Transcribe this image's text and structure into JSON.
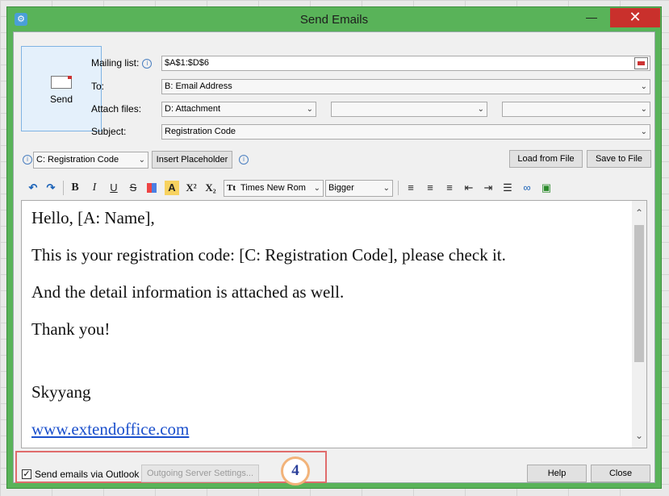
{
  "window": {
    "title": "Send Emails",
    "minimize_glyph": "—",
    "close_glyph": "✕"
  },
  "send_button": {
    "label": "Send",
    "icon": "envelope-icon"
  },
  "fields": {
    "mailing_list": {
      "label": "Mailing list:",
      "value": "$A$1:$D$6"
    },
    "to": {
      "label": "To:",
      "value": "B: Email Address"
    },
    "attach_files": {
      "label": "Attach files:",
      "values": [
        "D: Attachment",
        "",
        ""
      ]
    },
    "subject": {
      "label": "Subject:",
      "value": "Registration Code"
    }
  },
  "placeholder_row": {
    "field_value": "C: Registration Code",
    "insert_label": "Insert Placeholder",
    "load_label": "Load from File",
    "save_label": "Save to File"
  },
  "format_toolbar": {
    "bold": "B",
    "italic": "I",
    "underline": "U",
    "strike": "S",
    "font_color": "A",
    "superscript": "X²",
    "subscript": "X₂",
    "font_name": "Times New Rom",
    "font_size": "Bigger",
    "font_glyph": "Tt"
  },
  "editor": {
    "lines": [
      "Hello, [A: Name],",
      "This is your registration code: [C: Registration Code], please check it.",
      "And the detail information is attached as well.",
      "Thank you!"
    ],
    "signature": "Skyyang",
    "link": "www.extendoffice.com"
  },
  "footer": {
    "checkbox_label": "Send emails via Outlook",
    "checkbox_checked": true,
    "outgoing_label": "Outgoing Server Settings...",
    "callout": "4",
    "help_label": "Help",
    "close_label": "Close"
  },
  "colors": {
    "window_frame": "#59b359",
    "callout_ring": "#f2b37a",
    "highlight_box": "#e06c6c",
    "link": "#1a4fcc"
  }
}
